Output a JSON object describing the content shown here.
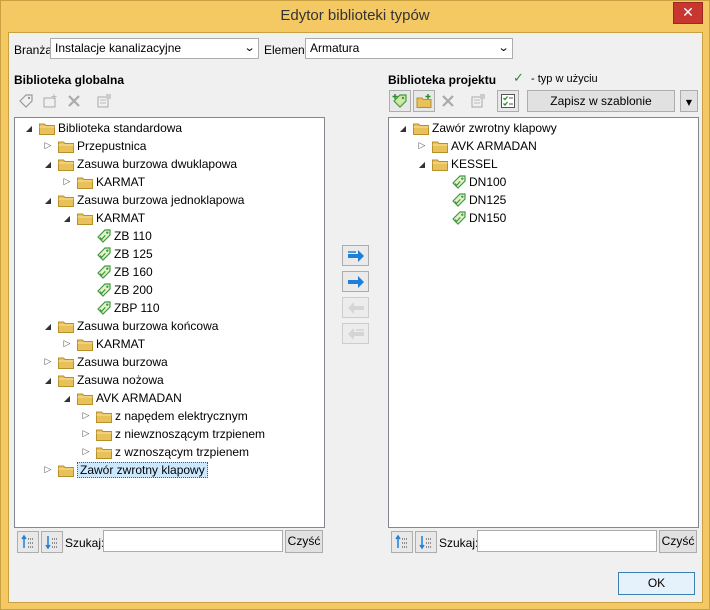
{
  "window": {
    "title": "Edytor biblioteki typów"
  },
  "filters": {
    "branch_label": "Branża",
    "branch_value": "Instalacje kanalizacyjne",
    "element_label": "Element",
    "element_value": "Armatura"
  },
  "global": {
    "title": "Biblioteka globalna",
    "search_label": "Szukaj:",
    "search_value": "",
    "clear_label": "Czyść",
    "tree": [
      {
        "label": "Biblioteka standardowa",
        "icon": "folder-icon",
        "expander": "expanded"
      },
      {
        "label": "Przepustnica",
        "icon": "folder-icon",
        "expander": "collapsed"
      },
      {
        "label": "Zasuwa burzowa dwuklapowa",
        "icon": "folder-icon",
        "expander": "expanded"
      },
      {
        "label": "KARMAT",
        "icon": "folder-icon",
        "expander": "collapsed"
      },
      {
        "label": "Zasuwa burzowa jednoklapowa",
        "icon": "folder-icon",
        "expander": "expanded"
      },
      {
        "label": "KARMAT",
        "icon": "folder-icon",
        "expander": "expanded"
      },
      {
        "label": "ZB 110",
        "icon": "tag-icon",
        "expander": "none"
      },
      {
        "label": "ZB 125",
        "icon": "tag-icon",
        "expander": "none"
      },
      {
        "label": "ZB 160",
        "icon": "tag-icon",
        "expander": "none"
      },
      {
        "label": "ZB 200",
        "icon": "tag-icon",
        "expander": "none"
      },
      {
        "label": "ZBP 110",
        "icon": "tag-icon",
        "expander": "none"
      },
      {
        "label": "Zasuwa burzowa końcowa",
        "icon": "folder-icon",
        "expander": "expanded"
      },
      {
        "label": "KARMAT",
        "icon": "folder-icon",
        "expander": "collapsed"
      },
      {
        "label": "Zasuwa burzowa",
        "icon": "folder-icon",
        "expander": "collapsed"
      },
      {
        "label": "Zasuwa nożowa",
        "icon": "folder-icon",
        "expander": "expanded"
      },
      {
        "label": "AVK ARMADAN",
        "icon": "folder-icon",
        "expander": "expanded"
      },
      {
        "label": "z napędem elektrycznym",
        "icon": "folder-icon",
        "expander": "collapsed"
      },
      {
        "label": "z niewznoszącym trzpienem",
        "icon": "folder-icon",
        "expander": "collapsed"
      },
      {
        "label": "z wznoszącym trzpienem",
        "icon": "folder-icon",
        "expander": "collapsed"
      },
      {
        "label": "Zawór zwrotny klapowy",
        "icon": "folder-icon",
        "expander": "collapsed",
        "selected": true
      }
    ]
  },
  "project": {
    "title": "Biblioteka projektu",
    "legend": "- typ w użyciu",
    "save_template_label": "Zapisz w szablonie",
    "search_label": "Szukaj:",
    "search_value": "",
    "clear_label": "Czyść",
    "tree": [
      {
        "label": "Zawór zwrotny klapowy",
        "icon": "folder-icon",
        "expander": "expanded"
      },
      {
        "label": "AVK ARMADAN",
        "icon": "folder-icon",
        "expander": "collapsed"
      },
      {
        "label": "KESSEL",
        "icon": "folder-icon",
        "expander": "expanded"
      },
      {
        "label": "DN100",
        "icon": "tag-icon",
        "expander": "none"
      },
      {
        "label": "DN125",
        "icon": "tag-icon",
        "expander": "none"
      },
      {
        "label": "DN150",
        "icon": "tag-icon",
        "expander": "none"
      }
    ]
  },
  "footer": {
    "ok_label": "OK"
  },
  "colors": {
    "folder": "#e8c15a",
    "tag": "#3f9a3f",
    "arrow_blue": "#1e7fd8",
    "selection": "#cce8ff"
  }
}
